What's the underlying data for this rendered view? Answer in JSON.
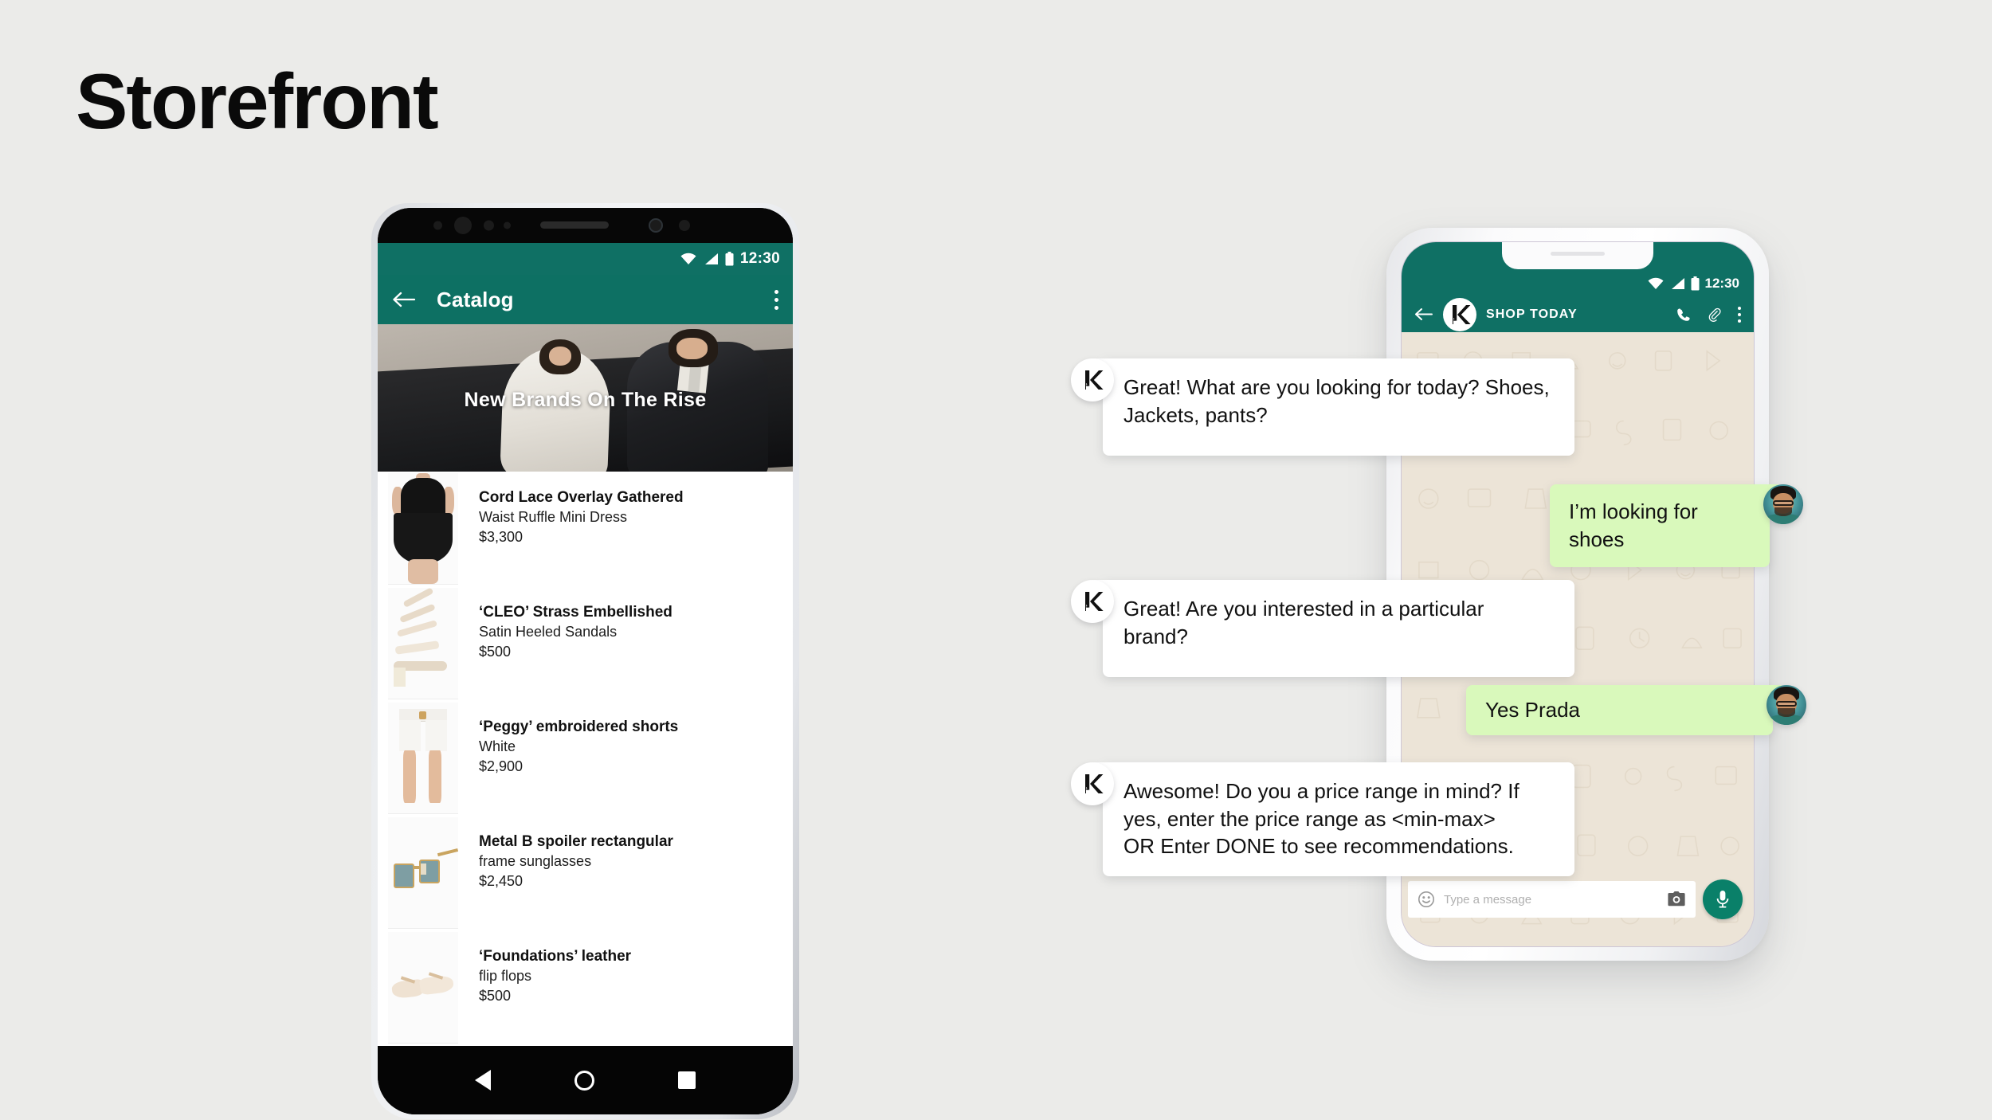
{
  "page": {
    "title": "Storefront",
    "background_color": "#ebebe9",
    "brand_green": "#0f7064",
    "outgoing_bubble_color": "#d9f9bb"
  },
  "catalog_phone": {
    "status_bar": {
      "clock": "12:30",
      "icons": [
        "wifi-icon",
        "signal-icon",
        "battery-icon"
      ]
    },
    "app_bar": {
      "back_label": "back-arrow",
      "title": "Catalog",
      "overflow_label": "more-options"
    },
    "hero": {
      "caption": "New Brands On The Rise"
    },
    "products": [
      {
        "name": "Cord Lace Overlay Gathered",
        "description": "Waist Ruffle Mini Dress",
        "price": "$3,300",
        "thumb": "black-lace-dress"
      },
      {
        "name": "‘CLEO’  Strass Embellished",
        "description": "Satin Heeled Sandals",
        "price": "$500",
        "thumb": "satin-heeled-sandal"
      },
      {
        "name": "‘Peggy’ embroidered shorts",
        "description": "White",
        "price": "$2,900",
        "thumb": "white-shorts"
      },
      {
        "name": "Metal B spoiler rectangular",
        "description": "frame sunglasses",
        "price": "$2,450",
        "thumb": "rectangular-sunglasses"
      },
      {
        "name": "‘Foundations’ leather",
        "description": "flip flops",
        "price": "$500",
        "thumb": "leather-flip-flops"
      }
    ],
    "nav_bar": {
      "back": "nav-back-triangle",
      "home": "nav-home-circle",
      "recents": "nav-recents-square"
    }
  },
  "chat_phone": {
    "status_bar": {
      "clock": "12:30",
      "icons": [
        "wifi-icon",
        "signal-icon",
        "battery-icon"
      ]
    },
    "app_bar": {
      "back_label": "back-arrow",
      "avatar_letter": "K",
      "contact_name": "SHOP TODAY",
      "actions": [
        "call-icon",
        "attach-icon",
        "more-options-icon"
      ]
    },
    "input_bar": {
      "emoji_icon": "emoji-icon",
      "placeholder": "Type a message",
      "camera_icon": "camera-icon",
      "mic_icon": "mic-icon"
    },
    "messages": [
      {
        "sender": "bot",
        "avatar_letter": "K",
        "text": "Great! What are you looking for today? Shoes, Jackets, pants?"
      },
      {
        "sender": "user",
        "text": "I’m looking for shoes"
      },
      {
        "sender": "bot",
        "avatar_letter": "K",
        "text": "Great! Are you interested in a particular brand?"
      },
      {
        "sender": "user",
        "text": "Yes Prada"
      },
      {
        "sender": "bot",
        "avatar_letter": "K",
        "text": "Awesome! Do you a price range in mind? If yes, enter the price range as <min-max>\nOR Enter DONE to see recommendations."
      }
    ]
  }
}
